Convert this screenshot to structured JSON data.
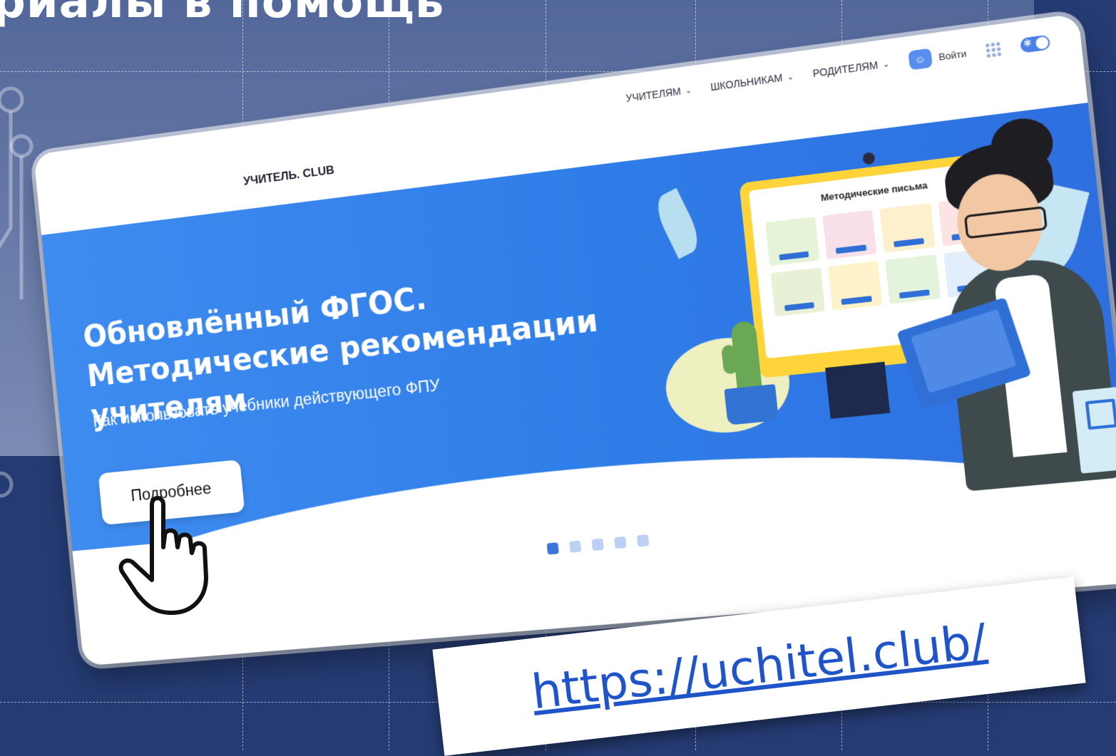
{
  "slide": {
    "title": "риалы в помощь"
  },
  "site": {
    "logo": "УЧИТЕЛЬ. CLUB",
    "nav": [
      {
        "label": "УЧИТЕЛЯМ"
      },
      {
        "label": "ШКОЛЬНИКАМ"
      },
      {
        "label": "РОДИТЕЛЯМ"
      }
    ],
    "login_label": "Войти",
    "hero": {
      "headline": "Обновлённый ФГОС. Методические рекомендации учителям",
      "subline": "Как использовать учебники действующего ФПУ",
      "button_label": "Подробнее"
    },
    "illustration": {
      "screen_title": "Методические письма",
      "tile_colors": [
        "#e6f3d8",
        "#f8e0ea",
        "#fdf0cc",
        "#fde4e4",
        "#e8f0d5",
        "#fdf2c9",
        "#e4f4dc",
        "#e3eefc"
      ]
    },
    "carousel": {
      "total": 5,
      "active": 1
    }
  },
  "url": "https://uchitel.club/",
  "colors": {
    "background": "#243b73",
    "hero_blue": "#3f8cf0",
    "accent": "#2f6fd6",
    "link": "#1f54c9"
  }
}
